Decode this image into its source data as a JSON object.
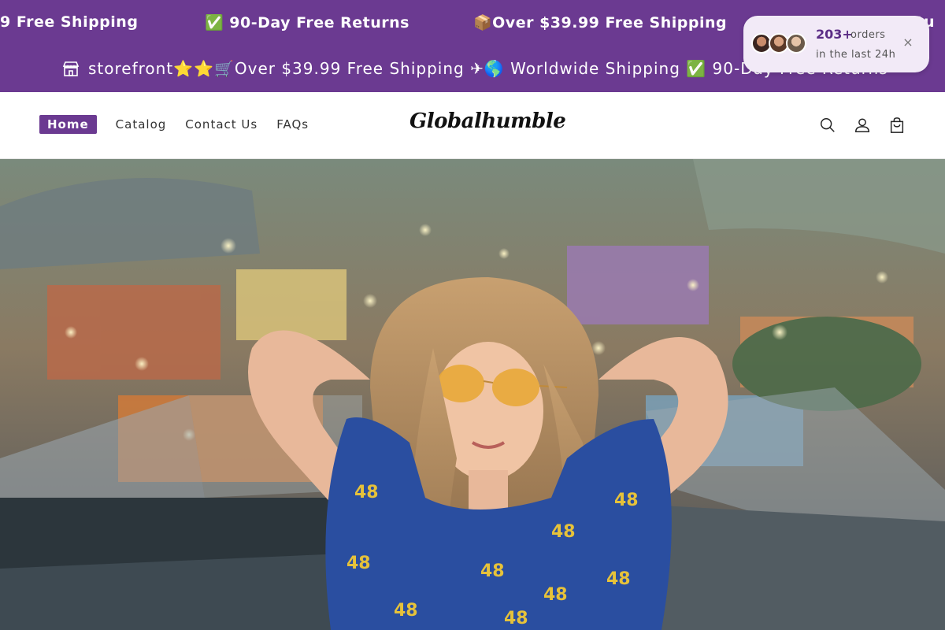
{
  "marquee": {
    "items": [
      "9 Free Shipping",
      "✅ 90-Day Free Returns",
      "📦Over $39.99 Free Shipping",
      "etu"
    ]
  },
  "announcement": {
    "text": "storefront⭐⭐🛒Over $39.99 Free Shipping ✈🌎 Worldwide Shipping ✅ 90-Day Free Returns"
  },
  "orders_popup": {
    "count": "203+",
    "label": "orders",
    "subtext": "in the last 24h",
    "close": "×"
  },
  "nav": {
    "items": [
      "Home",
      "Catalog",
      "Contact Us",
      "FAQs"
    ]
  },
  "logo": {
    "text": "Globalhumble"
  },
  "colors": {
    "brand": "#6b3a91",
    "popup_bg": "#f2eaf7"
  },
  "icons": [
    "store-icon",
    "search-icon",
    "account-icon",
    "cart-icon",
    "close-icon"
  ]
}
